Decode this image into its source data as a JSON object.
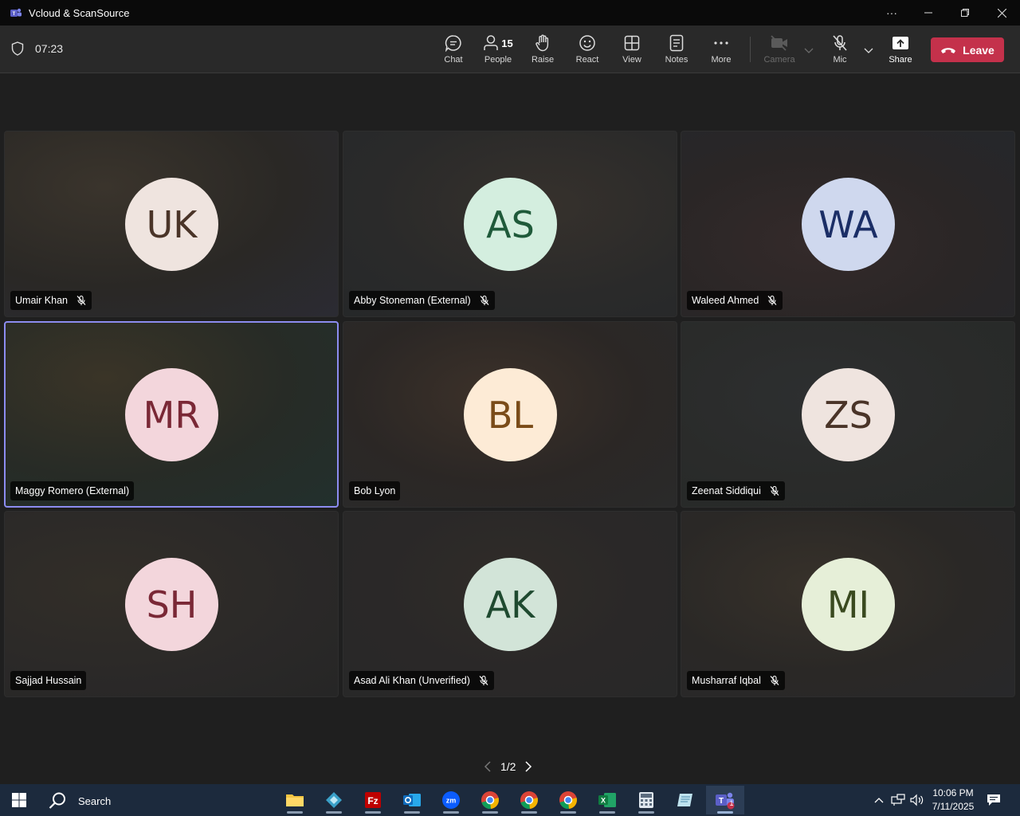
{
  "window": {
    "title": "Vcloud & ScanSource"
  },
  "toolbar": {
    "timer": "07:23",
    "chat_label": "Chat",
    "people_label": "People",
    "people_count": "15",
    "raise_label": "Raise",
    "react_label": "React",
    "view_label": "View",
    "notes_label": "Notes",
    "more_label": "More",
    "camera_label": "Camera",
    "mic_label": "Mic",
    "share_label": "Share",
    "leave_label": "Leave"
  },
  "participants": [
    {
      "initials": "UK",
      "name": "Umair Khan",
      "muted": true,
      "avatar_bg": "#efe4df",
      "avatar_fg": "#4a3428"
    },
    {
      "initials": "AS",
      "name": "Abby Stoneman (External)",
      "muted": true,
      "avatar_bg": "#d4eedf",
      "avatar_fg": "#1f5a3a"
    },
    {
      "initials": "WA",
      "name": "Waleed Ahmed",
      "muted": true,
      "avatar_bg": "#cfd8ee",
      "avatar_fg": "#1b2e66"
    },
    {
      "initials": "MR",
      "name": "Maggy Romero (External)",
      "muted": false,
      "active": true,
      "avatar_bg": "#f3d6dc",
      "avatar_fg": "#7a2836"
    },
    {
      "initials": "BL",
      "name": "Bob Lyon",
      "muted": false,
      "avatar_bg": "#fdebd6",
      "avatar_fg": "#7a4b18"
    },
    {
      "initials": "ZS",
      "name": "Zeenat Siddiqui",
      "muted": true,
      "avatar_bg": "#efe4df",
      "avatar_fg": "#4a3428"
    },
    {
      "initials": "SH",
      "name": "Sajjad Hussain",
      "muted": false,
      "avatar_bg": "#f3d6dc",
      "avatar_fg": "#7a2836"
    },
    {
      "initials": "AK",
      "name": "Asad Ali Khan (Unverified)",
      "muted": true,
      "avatar_bg": "#d2e4d8",
      "avatar_fg": "#1f4a30"
    },
    {
      "initials": "MI",
      "name": "Musharraf Iqbal",
      "muted": true,
      "avatar_bg": "#e6efd8",
      "avatar_fg": "#3a4a1f"
    }
  ],
  "pager": {
    "text": "1/2"
  },
  "taskbar": {
    "search_label": "Search",
    "apps": [
      "file-explorer",
      "app-diamond",
      "filezilla",
      "outlook",
      "zoom",
      "chrome",
      "chrome",
      "chrome",
      "excel",
      "calculator",
      "notepad",
      "teams"
    ],
    "teams_badge": "1",
    "time": "10:06 PM",
    "date": "7/11/2025"
  },
  "colors": {
    "leave": "#c4314b",
    "active_border": "#8c8cf0",
    "toolbar": "#292929"
  }
}
